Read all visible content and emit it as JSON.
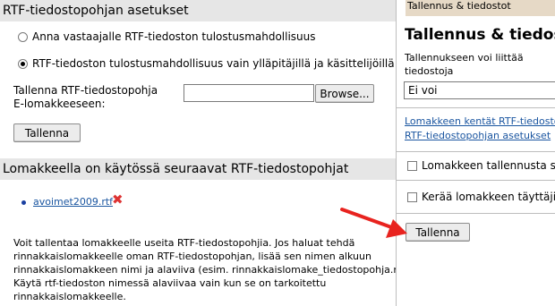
{
  "left": {
    "header1": "RTF-tiedostopohjan asetukset",
    "radio1_label": "Anna vastaajalle RTF-tiedoston tulostusmahdollisuus",
    "radio2_label": "RTF-tiedoston tulostusmahdollisuus vain ylläpitäjillä ja käsittelijöillä",
    "radio_selected": 2,
    "save_template_label_line1": "Tallenna RTF-tiedostopohja",
    "save_template_label_line2": "E-lomakkeeseen:",
    "file_input_value": "",
    "browse_button": "Browse...",
    "save_button": "Tallenna",
    "header2": "Lomakkeella on käytössä seuraavat RTF-tiedostopohjat",
    "templates": [
      {
        "name": "avoimet2009.rtf"
      }
    ],
    "info_lines": [
      "Voit tallentaa lomakkeelle useita RTF-tiedostopohjia. Jos haluat tehdä",
      "rinnakkaislomakkeelle oman RTF-tiedostopohjan, lisää sen nimen alkuun",
      "rinnakkaislomakkeen nimi ja alaviiva (esim. rinnakkaislomake_tiedostopohja.rtf).",
      "Käytä rtf-tiedoston nimessä alaviivaa vain kun se on tarkoitettu",
      "rinnakkaislomakkeelle."
    ]
  },
  "right": {
    "tab_label": "Tallennus & tiedostot",
    "title": "Tallennus & tiedostot",
    "attach_label_line1": "Tallennukseen voi liittää",
    "attach_label_line2": "tiedostoja",
    "attach_select_value": "Ei voi",
    "link1": "Lomakkeen kentät RTF-tiedostoon",
    "link2": "RTF-tiedostopohjan asetukset",
    "checkbox1_label": "Lomakkeen tallennusta saa",
    "checkbox2_label": "Kerää lomakkeen täyttäjistä",
    "save_button": "Tallenna"
  },
  "colors": {
    "section_header_bg": "#e6e6e6",
    "right_tab_bg": "#e6d9c6",
    "link": "#1a55a0",
    "arrow": "#e8231f",
    "delete_icon": "#dd3333"
  },
  "icons": {
    "delete": "close-x-icon",
    "arrow": "red-arrow-annotation"
  }
}
